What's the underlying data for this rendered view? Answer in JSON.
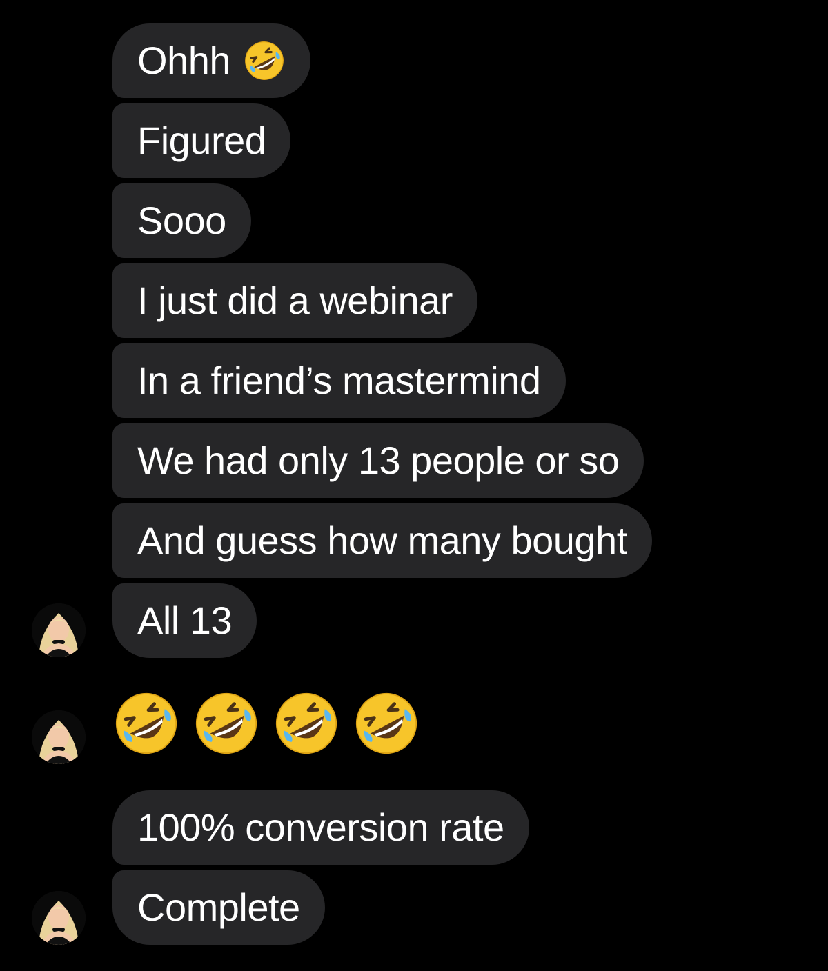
{
  "conversation": {
    "messages": [
      {
        "text": "Ohhh",
        "emoji": "rolling-on-floor-laughing"
      },
      {
        "text": "Figured"
      },
      {
        "text": "Sooo"
      },
      {
        "text": "I just did a webinar"
      },
      {
        "text": "In a friend’s mastermind"
      },
      {
        "text": "We had only 13 people or so"
      },
      {
        "text": "And guess how many bought"
      },
      {
        "text": "All 13"
      },
      {
        "emoji_only": [
          "rolling-on-floor-laughing",
          "rolling-on-floor-laughing",
          "rolling-on-floor-laughing",
          "rolling-on-floor-laughing"
        ]
      },
      {
        "text": "100% conversion rate"
      },
      {
        "text": "Complete"
      }
    ]
  },
  "theme": {
    "background": "#000000",
    "bubble_color": "#262628",
    "text_color": "#ffffff",
    "emoji_yellow": "#f7c52a"
  },
  "icons": {
    "avatar": "sender-avatar",
    "emoji": "rolling-on-floor-laughing-emoji"
  }
}
